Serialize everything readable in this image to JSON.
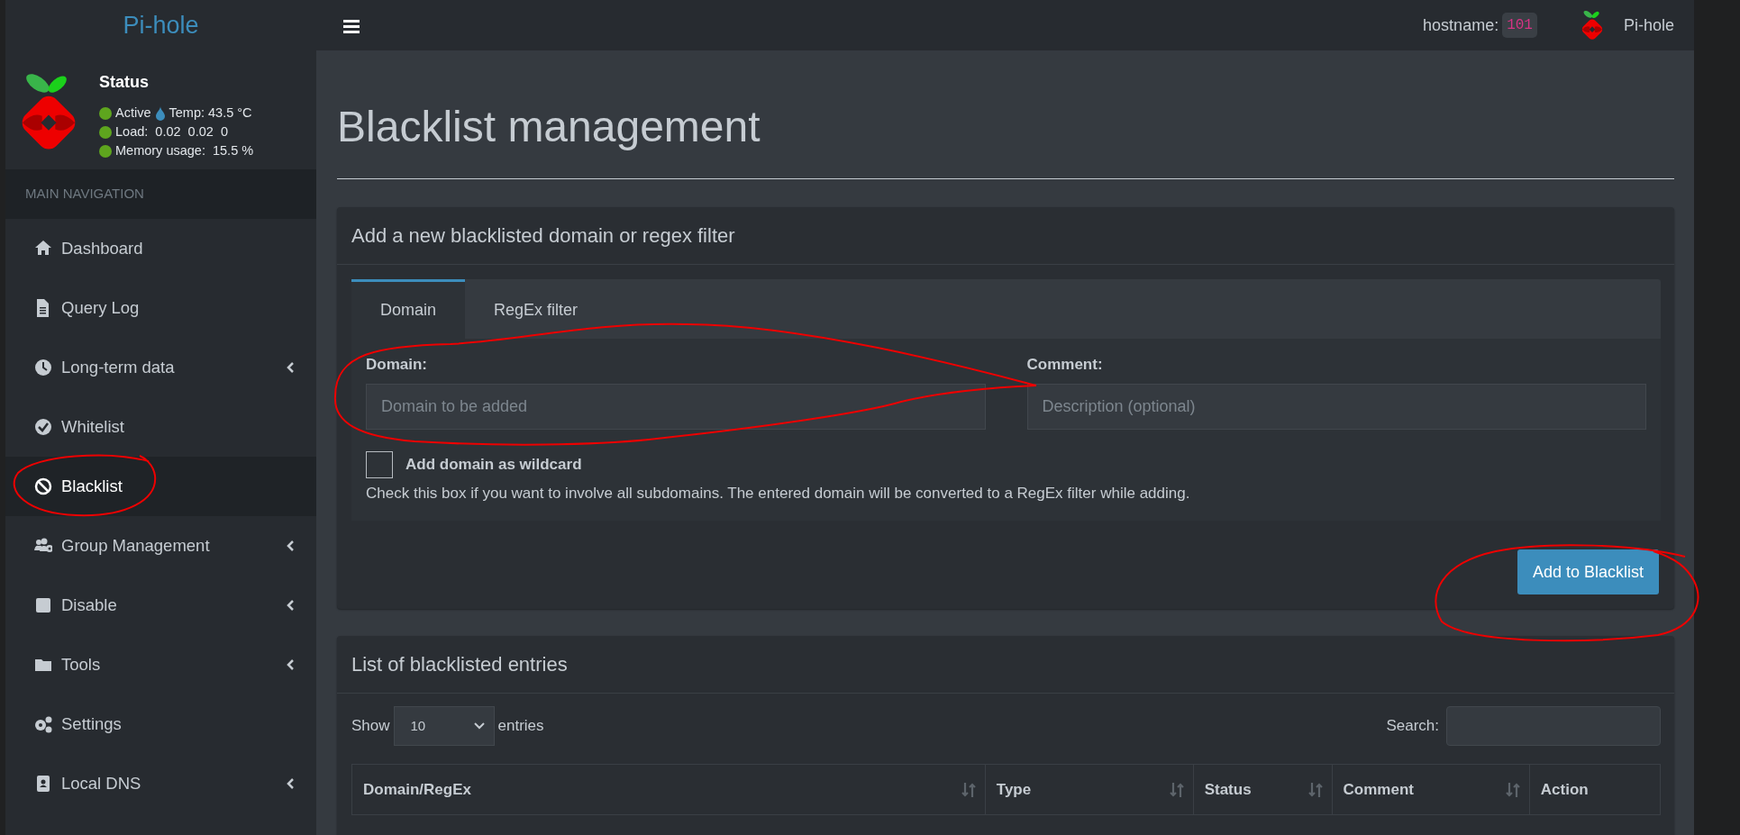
{
  "header": {
    "logo": "Pi-hole",
    "hostname_label": "hostname:",
    "hostname": "101",
    "user": "Pi-hole"
  },
  "status": {
    "title": "Status",
    "active": "Active",
    "temp": "Temp: 43.5 °C",
    "load": "Load:  0.02  0.02  0",
    "memory": "Memory usage:  15.5 %"
  },
  "sidebar": {
    "header": "MAIN NAVIGATION",
    "items": [
      {
        "label": "Dashboard",
        "selected": false,
        "has_submenu": false
      },
      {
        "label": "Query Log",
        "selected": false,
        "has_submenu": false
      },
      {
        "label": "Long-term data",
        "selected": false,
        "has_submenu": true
      },
      {
        "label": "Whitelist",
        "selected": false,
        "has_submenu": false
      },
      {
        "label": "Blacklist",
        "selected": true,
        "has_submenu": false
      },
      {
        "label": "Group Management",
        "selected": false,
        "has_submenu": true
      },
      {
        "label": "Disable",
        "selected": false,
        "has_submenu": true
      },
      {
        "label": "Tools",
        "selected": false,
        "has_submenu": true
      },
      {
        "label": "Settings",
        "selected": false,
        "has_submenu": false
      },
      {
        "label": "Local DNS",
        "selected": false,
        "has_submenu": true
      }
    ]
  },
  "page": {
    "title": "Blacklist management"
  },
  "add_box": {
    "title": "Add a new blacklisted domain or regex filter",
    "tabs": [
      {
        "label": "Domain",
        "selected": true
      },
      {
        "label": "RegEx filter",
        "selected": false
      }
    ],
    "domain": {
      "label": "Domain:",
      "placeholder": "Domain to be added"
    },
    "comment": {
      "label": "Comment:",
      "placeholder": "Description (optional)"
    },
    "wildcard": {
      "label": "Add domain as wildcard",
      "checked": false,
      "help": "Check this box if you want to involve all subdomains. The entered domain will be converted to a RegEx filter while adding."
    },
    "button": "Add to Blacklist"
  },
  "list_box": {
    "title": "List of blacklisted entries",
    "show_label": "Show",
    "page_size": "10",
    "entries_label": "entries",
    "search_label": "Search:",
    "columns": [
      {
        "label": "Domain/RegEx",
        "sortable": true
      },
      {
        "label": "Type",
        "sortable": true
      },
      {
        "label": "Status",
        "sortable": true
      },
      {
        "label": "Comment",
        "sortable": true
      },
      {
        "label": "Action",
        "sortable": false
      }
    ]
  }
}
